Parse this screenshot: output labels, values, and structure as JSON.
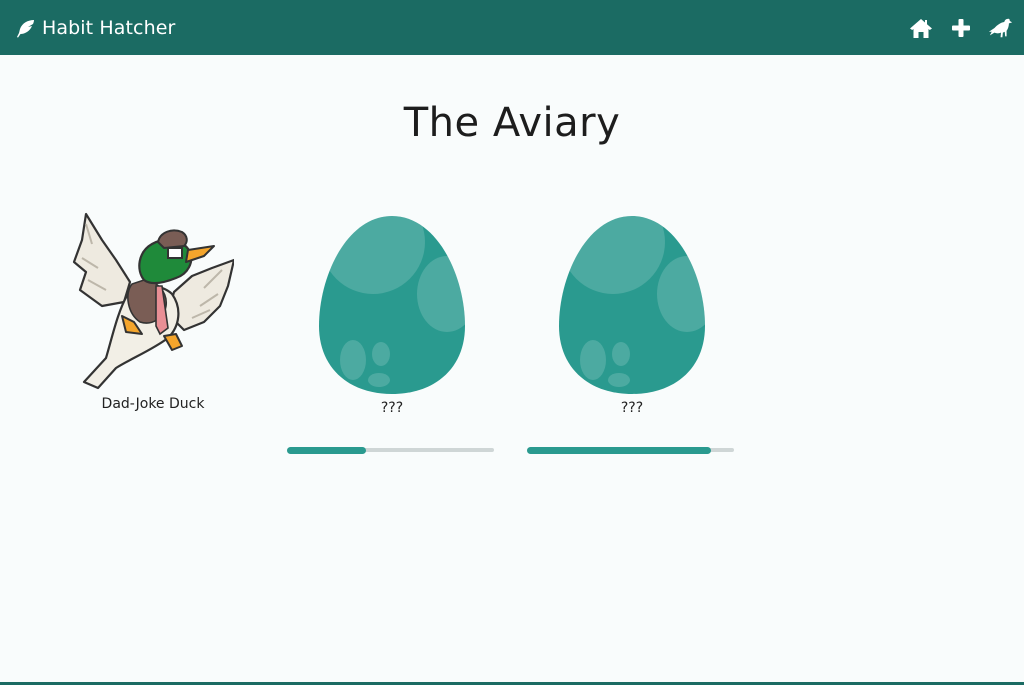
{
  "app": {
    "brand_name": "Habit Hatcher",
    "brand_icon": "feather-icon",
    "nav_icons": [
      "home-icon",
      "plus-icon",
      "bird-icon"
    ],
    "colors": {
      "navbar": "#1b6b63",
      "accent": "#2a9a8f",
      "egg": "#2a9a8f",
      "background": "#f9fcfc"
    }
  },
  "page": {
    "title": "The Aviary"
  },
  "aviary": {
    "birds": [
      {
        "name": "Dad-Joke Duck",
        "kind": "hatched-duck"
      }
    ],
    "eggs": [
      {
        "name": "???",
        "progress": 0.38
      },
      {
        "name": "???",
        "progress": 0.89
      }
    ]
  }
}
